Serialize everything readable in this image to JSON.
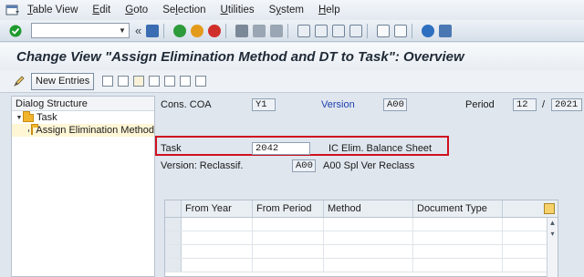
{
  "menubar": {
    "items": [
      "Table View",
      "Edit",
      "Goto",
      "Selection",
      "Utilities",
      "System",
      "Help"
    ],
    "underlines": [
      "T",
      "E",
      "G",
      "l",
      "U",
      "y",
      "H"
    ]
  },
  "toolbar": {
    "command_value": "",
    "back_symbol": "«"
  },
  "title": "Change View \"Assign Elimination Method and DT to Task\": Overview",
  "appbar": {
    "new_entries": "New Entries"
  },
  "dialog": {
    "header": "Dialog Structure",
    "tree": [
      {
        "label": "Task",
        "level": 0,
        "expanded": true,
        "selected": false
      },
      {
        "label": "Assign Elimination Method",
        "level": 1,
        "expanded": false,
        "selected": true
      }
    ]
  },
  "fields": {
    "cons_coa_label": "Cons. COA",
    "cons_coa_value": "Y1",
    "version_label": "Version",
    "version_value": "A00",
    "period_label": "Period",
    "period_value": "12",
    "period_sep": "/",
    "year_value": "2021",
    "task_label": "Task",
    "task_value": "2042",
    "task_desc": "IC Elim. Balance Sheet",
    "version_reclass_label": "Version: Reclassif.",
    "version_reclass_value": "A00",
    "version_reclass_desc": "A00 Spl Ver Reclass"
  },
  "table": {
    "columns": [
      "From Year",
      "From Period",
      "Method",
      "Document Type"
    ],
    "rows": 5
  },
  "colors": {
    "highlight_box": "#d0101e",
    "version_label": "#2040b0"
  }
}
